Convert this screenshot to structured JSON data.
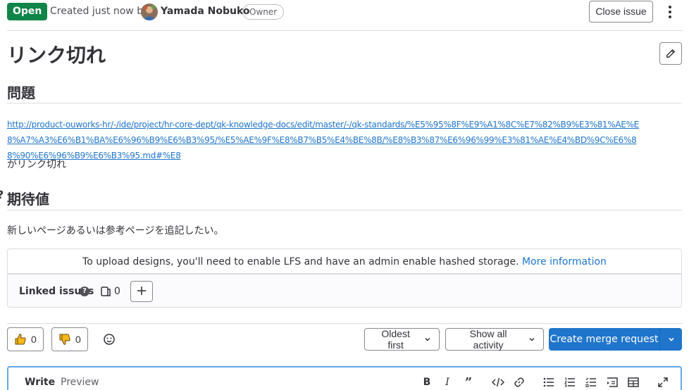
{
  "header": {
    "status": "Open",
    "created_text": "Created just now by",
    "author": "Yamada Nobuko",
    "role_badge": "Owner",
    "close_button": "Close issue"
  },
  "issue": {
    "title": "リンク切れ",
    "sections": [
      {
        "heading": "問題",
        "link": "http://product-ouworks-hr/-/ide/project/hr-core-dept/qk-knowledge-docs/edit/master/-/qk-standards/%E5%95%8F%E9%A1%8C%E7%82%B9%E3%81%AE%E8%A7%A3%E6%B1%BA%E6%96%B9%E6%B3%95/%E5%AE%9F%E8%B7%B5%E4%BE%8B/%E8%B3%87%E6%96%99%E3%81%AE%E4%BD%9C%E6%88%90%E6%96%B9%E6%B3%95.md#%E8",
        "text": "がリンク切れ"
      },
      {
        "heading": "期待値",
        "text": "新しいページあるいは参考ページを追記したい。"
      }
    ]
  },
  "designs": {
    "message": "To upload designs, you'll need to enable LFS and have an admin enable hashed storage.",
    "link": "More information"
  },
  "linked_issues": {
    "label": "Linked issues",
    "count": "0",
    "help_icon": "question-icon",
    "add_icon": "plus-icon"
  },
  "reactions": {
    "thumbs_up": "0",
    "thumbs_down": "0"
  },
  "activity": {
    "sort": "Oldest first",
    "filter": "Show all activity",
    "create_mr": "Create merge request"
  },
  "editor": {
    "tabs": [
      "Write",
      "Preview"
    ],
    "toolbar_icons": [
      "bold-icon",
      "italic-icon",
      "quote-icon",
      "code-icon",
      "link-icon",
      "bullet-list-icon",
      "numbered-list-icon",
      "task-list-icon",
      "collapsible-icon",
      "table-icon",
      "fullscreen-icon"
    ]
  },
  "colors": {
    "open_green": "#108548",
    "link_blue": "#1f75cb",
    "primary_button": "#1f75cb"
  }
}
